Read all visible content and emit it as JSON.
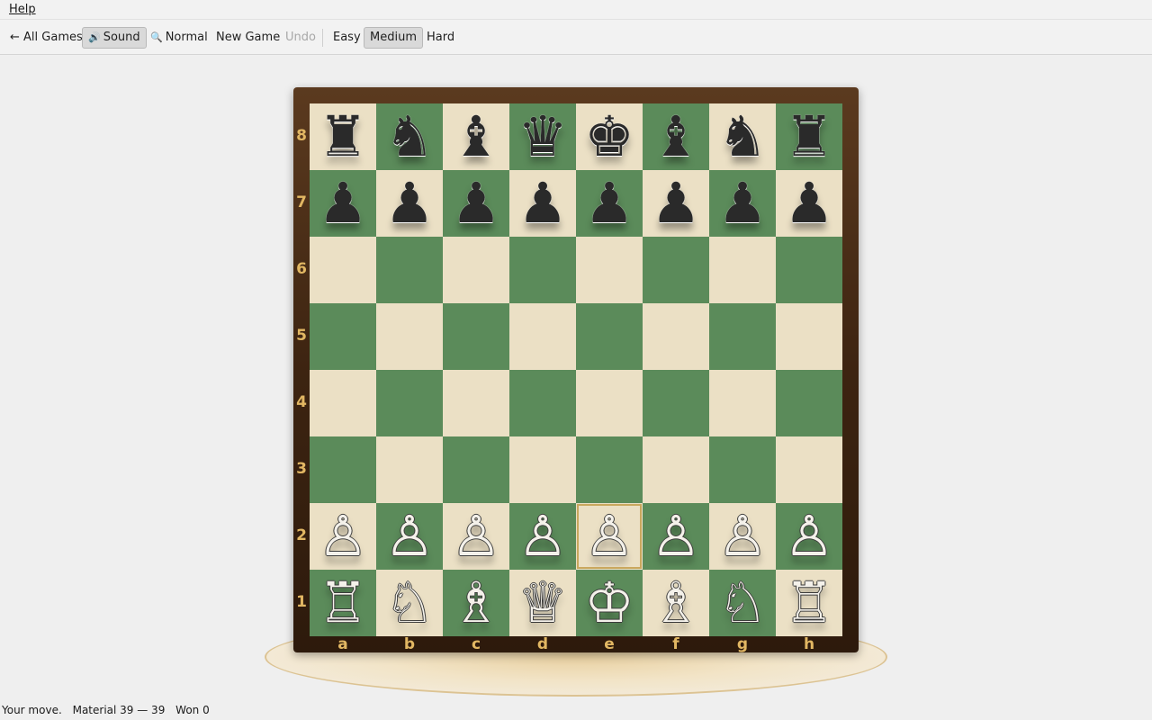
{
  "menubar": {
    "help": "Help"
  },
  "toolbar": {
    "all_games": "← All Games",
    "sound_icon": "🔊",
    "sound": "Sound",
    "normal_icon": "🔍",
    "normal": "Normal",
    "new_game": "New Game",
    "undo": "Undo",
    "easy": "Easy",
    "medium": "Medium",
    "hard": "Hard"
  },
  "board": {
    "ranks": [
      "8",
      "7",
      "6",
      "5",
      "4",
      "3",
      "2",
      "1"
    ],
    "files": [
      "a",
      "b",
      "c",
      "d",
      "e",
      "f",
      "g",
      "h"
    ],
    "selected_square": "e2",
    "rows": [
      [
        "♜",
        "♞",
        "♝",
        "♛",
        "♚",
        "♝",
        "♞",
        "♜"
      ],
      [
        "♟",
        "♟",
        "♟",
        "♟",
        "♟",
        "♟",
        "♟",
        "♟"
      ],
      [
        "",
        "",
        "",
        "",
        "",
        "",
        "",
        ""
      ],
      [
        "",
        "",
        "",
        "",
        "",
        "",
        "",
        ""
      ],
      [
        "",
        "",
        "",
        "",
        "",
        "",
        "",
        ""
      ],
      [
        "",
        "",
        "",
        "",
        "",
        "",
        "",
        ""
      ],
      [
        "♙",
        "♙",
        "♙",
        "♙",
        "♙",
        "♙",
        "♙",
        "♙"
      ],
      [
        "♖",
        "♘",
        "♗",
        "♕",
        "♔",
        "♗",
        "♘",
        "♖"
      ]
    ],
    "colors": {
      "light": "#ebe0c5",
      "dark": "#5b8b5a",
      "label": "#e2b763",
      "frame": "#3d2411"
    }
  },
  "status": {
    "message": "Your move.",
    "material": "Material 39 — 39",
    "won": "Won 0"
  }
}
